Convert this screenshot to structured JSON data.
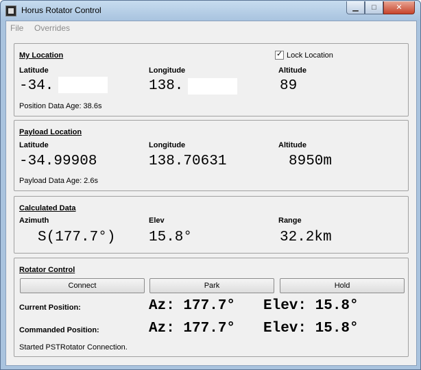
{
  "window": {
    "title": "Horus Rotator Control",
    "controls": {
      "minimize": "▁",
      "maximize": "□",
      "close": "✕"
    }
  },
  "menu": {
    "items": [
      "File",
      "Overrides"
    ]
  },
  "my_location": {
    "title": "My Location",
    "lock_label": "Lock Location",
    "lock_checked": true,
    "latitude_label": "Latitude",
    "longitude_label": "Longitude",
    "altitude_label": "Altitude",
    "latitude": "-34.",
    "longitude": "138.",
    "altitude": "89",
    "age": "Position Data Age: 38.6s"
  },
  "payload_location": {
    "title": "Payload Location",
    "latitude_label": "Latitude",
    "longitude_label": "Longitude",
    "altitude_label": "Altitude",
    "latitude": "-34.99908",
    "longitude": "138.70631",
    "altitude": "8950m",
    "age": "Payload Data Age: 2.6s"
  },
  "calculated": {
    "title": "Calculated Data",
    "azimuth_label": "Azimuth",
    "elev_label": "Elev",
    "range_label": "Range",
    "azimuth": "S(177.7°)",
    "elev": "15.8°",
    "range": "32.2km"
  },
  "rotator": {
    "title": "Rotator Control",
    "connect_label": "Connect",
    "park_label": "Park",
    "hold_label": "Hold",
    "current_label": "Current Position:",
    "current_az": "Az: 177.7°",
    "current_elev": "Elev: 15.8°",
    "commanded_label": "Commanded Position:",
    "commanded_az": "Az: 177.7°",
    "commanded_elev": "Elev: 15.8°",
    "status": "Started PSTRotator Connection."
  }
}
